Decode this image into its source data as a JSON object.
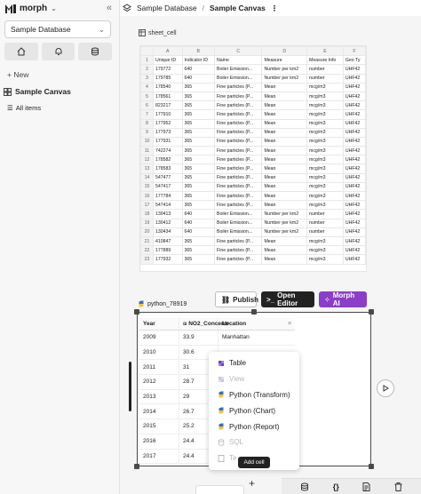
{
  "app": {
    "name": "morph"
  },
  "sidebar": {
    "database_select": "Sample Database",
    "new_label": "New",
    "canvas_label": "Sample Canvas",
    "all_items_label": "All items"
  },
  "header": {
    "breadcrumb_db": "Sample Database",
    "breadcrumb_sep": "/",
    "breadcrumb_canvas": "Sample Canvas"
  },
  "sheet": {
    "label": "sheet_cell",
    "columns": [
      "A",
      "B",
      "C",
      "D",
      "E",
      "F"
    ],
    "headers": [
      "Unique ID",
      "Indicator ID",
      "Name",
      "Measure",
      "Measure Info",
      "Geo Ty"
    ],
    "rows": [
      [
        "179772",
        "640",
        "Boiler Emission...",
        "Number per km2",
        "number",
        "UHF42"
      ],
      [
        "179785",
        "640",
        "Boiler Emission...",
        "Number per km2",
        "number",
        "UHF42"
      ],
      [
        "178540",
        "365",
        "Fine particles (P...",
        "Mean",
        "mcg/m3",
        "UHF42"
      ],
      [
        "178561",
        "365",
        "Fine particles (P...",
        "Mean",
        "mcg/m3",
        "UHF42"
      ],
      [
        "823217",
        "365",
        "Fine particles (P...",
        "Mean",
        "mcg/m3",
        "UHF42"
      ],
      [
        "177910",
        "365",
        "Fine particles (P...",
        "Mean",
        "mcg/m3",
        "UHF42"
      ],
      [
        "177952",
        "365",
        "Fine particles (P...",
        "Mean",
        "mcg/m3",
        "UHF42"
      ],
      [
        "177973",
        "365",
        "Fine particles (P...",
        "Mean",
        "mcg/m3",
        "UHF42"
      ],
      [
        "177931",
        "365",
        "Fine particles (P...",
        "Mean",
        "mcg/m3",
        "UHF42"
      ],
      [
        "742274",
        "365",
        "Fine particles (P...",
        "Mean",
        "mcg/m3",
        "UHF42"
      ],
      [
        "178582",
        "365",
        "Fine particles (P...",
        "Mean",
        "mcg/m3",
        "UHF42"
      ],
      [
        "178583",
        "365",
        "Fine particles (P...",
        "Mean",
        "mcg/m3",
        "UHF42"
      ],
      [
        "547477",
        "365",
        "Fine particles (P...",
        "Mean",
        "mcg/m3",
        "UHF42"
      ],
      [
        "547417",
        "365",
        "Fine particles (P...",
        "Mean",
        "mcg/m3",
        "UHF42"
      ],
      [
        "177784",
        "365",
        "Fine particles (P...",
        "Mean",
        "mcg/m3",
        "UHF42"
      ],
      [
        "547414",
        "365",
        "Fine particles (P...",
        "Mean",
        "mcg/m3",
        "UHF42"
      ],
      [
        "130413",
        "640",
        "Boiler Emission...",
        "Number per km2",
        "number",
        "UHF42"
      ],
      [
        "130412",
        "640",
        "Boiler Emission...",
        "Number per km2",
        "number",
        "UHF42"
      ],
      [
        "130434",
        "640",
        "Boiler Emission...",
        "Number per km2",
        "number",
        "UHF42"
      ],
      [
        "410847",
        "365",
        "Fine particles (P...",
        "Mean",
        "mcg/m3",
        "UHF42"
      ],
      [
        "177889",
        "365",
        "Fine particles (P...",
        "Mean",
        "mcg/m3",
        "UHF42"
      ],
      [
        "177932",
        "365",
        "Fine particles (P...",
        "Mean",
        "mcg/m3",
        "UHF42"
      ]
    ]
  },
  "python_cell": {
    "label": "python_78919",
    "publish_label": "Publish",
    "open_editor_label": "Open Editor",
    "morph_ai_label": "Morph AI",
    "table_headers": [
      "Year",
      "NO2_Concentr",
      "Location"
    ],
    "rows": [
      [
        "2009",
        "33.9",
        "Manhattan"
      ],
      [
        "2010",
        "30.6",
        ""
      ],
      [
        "2011",
        "31",
        ""
      ],
      [
        "2012",
        "28.7",
        ""
      ],
      [
        "2013",
        "29",
        ""
      ],
      [
        "2014",
        "26.7",
        ""
      ],
      [
        "2015",
        "25.2",
        ""
      ],
      [
        "2016",
        "24.4",
        ""
      ],
      [
        "2017",
        "24.4",
        ""
      ]
    ]
  },
  "add_menu": {
    "items": [
      {
        "label": "Table",
        "icon": "table-icon",
        "enabled": true
      },
      {
        "label": "View",
        "icon": "view-icon",
        "enabled": false
      },
      {
        "label": "Python (Transform)",
        "icon": "python-icon",
        "enabled": true
      },
      {
        "label": "Python (Chart)",
        "icon": "python-icon",
        "enabled": true
      },
      {
        "label": "Python (Report)",
        "icon": "python-icon",
        "enabled": true
      },
      {
        "label": "SQL",
        "icon": "database-icon",
        "enabled": false
      },
      {
        "label": "Te",
        "icon": "text-icon",
        "enabled": false
      }
    ],
    "tooltip": "Add cell"
  },
  "colors": {
    "accent_purple": "#8b3ec7",
    "dark": "#222222",
    "python_blue": "#3a6fb5",
    "python_yellow": "#f0c33a"
  }
}
